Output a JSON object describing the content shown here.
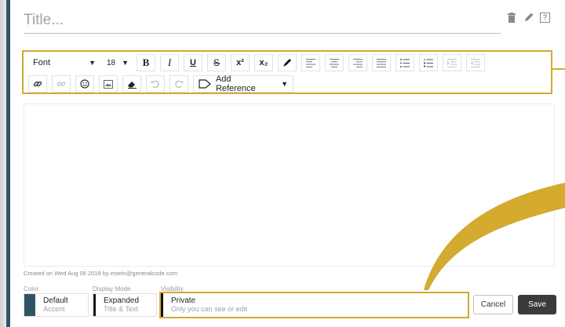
{
  "title": {
    "placeholder": "Title...",
    "value": ""
  },
  "header_icons": [
    "trash-icon",
    "pencil-icon",
    "help-icon"
  ],
  "help_glyph": "?",
  "toolbar": {
    "font_label": "Font",
    "size_label": "18",
    "bold": "B",
    "italic": "I",
    "underline": "U",
    "strike": "S",
    "superscript": "x²",
    "subscript": "x₂",
    "add_reference": "Add Reference"
  },
  "meta": {
    "created": "Created on Wed Aug 08 2018 by estein@generalcode.com"
  },
  "options": {
    "color": {
      "label": "Color",
      "value": "Default",
      "sub": "Accent",
      "swatch": "#2f5564"
    },
    "display_mode": {
      "label": "Display Mode",
      "value": "Expanded",
      "sub": "Title & Text"
    },
    "visibility": {
      "label": "Visibility",
      "value": "Private",
      "sub": "Only you can see or edit"
    }
  },
  "buttons": {
    "cancel": "Cancel",
    "save": "Save"
  },
  "colors": {
    "accent": "#2f5564",
    "highlight": "#d4aa2f",
    "save_bg": "#3b3b3b"
  }
}
